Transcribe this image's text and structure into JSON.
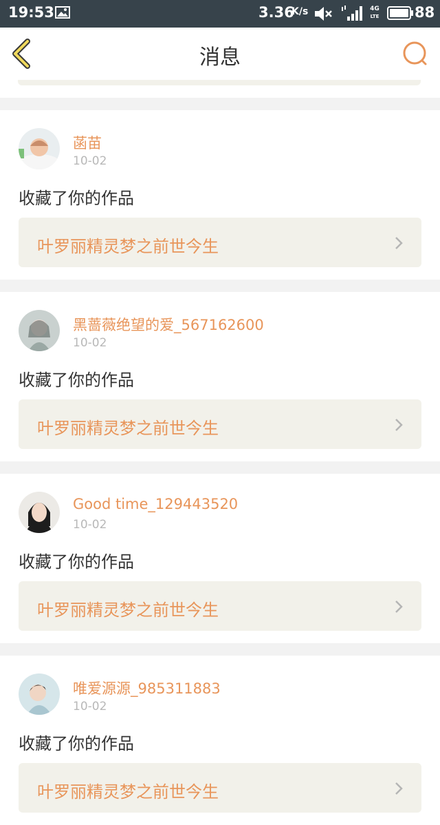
{
  "status_bar": {
    "time": "19:53",
    "speed": "3.36",
    "speed_unit": "K/s",
    "network": "4G",
    "network_sub": "LTE",
    "battery": "88",
    "icons": [
      "image-icon",
      "mute-icon",
      "signal-icon",
      "battery-icon"
    ]
  },
  "nav": {
    "title": "消息",
    "back_icon": "chevron-left-icon",
    "search_icon": "search-icon",
    "accent_color": "#e8955a"
  },
  "messages": [
    {
      "user": "菡苗",
      "date": "10-02",
      "text": "收藏了你的作品",
      "work": "叶罗丽精灵梦之前世今生"
    },
    {
      "user": "黑蔷薇绝望的爱_567162600",
      "date": "10-02",
      "text": "收藏了你的作品",
      "work": "叶罗丽精灵梦之前世今生"
    },
    {
      "user": "Good time_129443520",
      "date": "10-02",
      "text": "收藏了你的作品",
      "work": "叶罗丽精灵梦之前世今生"
    },
    {
      "user": "唯爱源源_985311883",
      "date": "10-02",
      "text": "收藏了你的作品",
      "work": "叶罗丽精灵梦之前世今生"
    }
  ]
}
